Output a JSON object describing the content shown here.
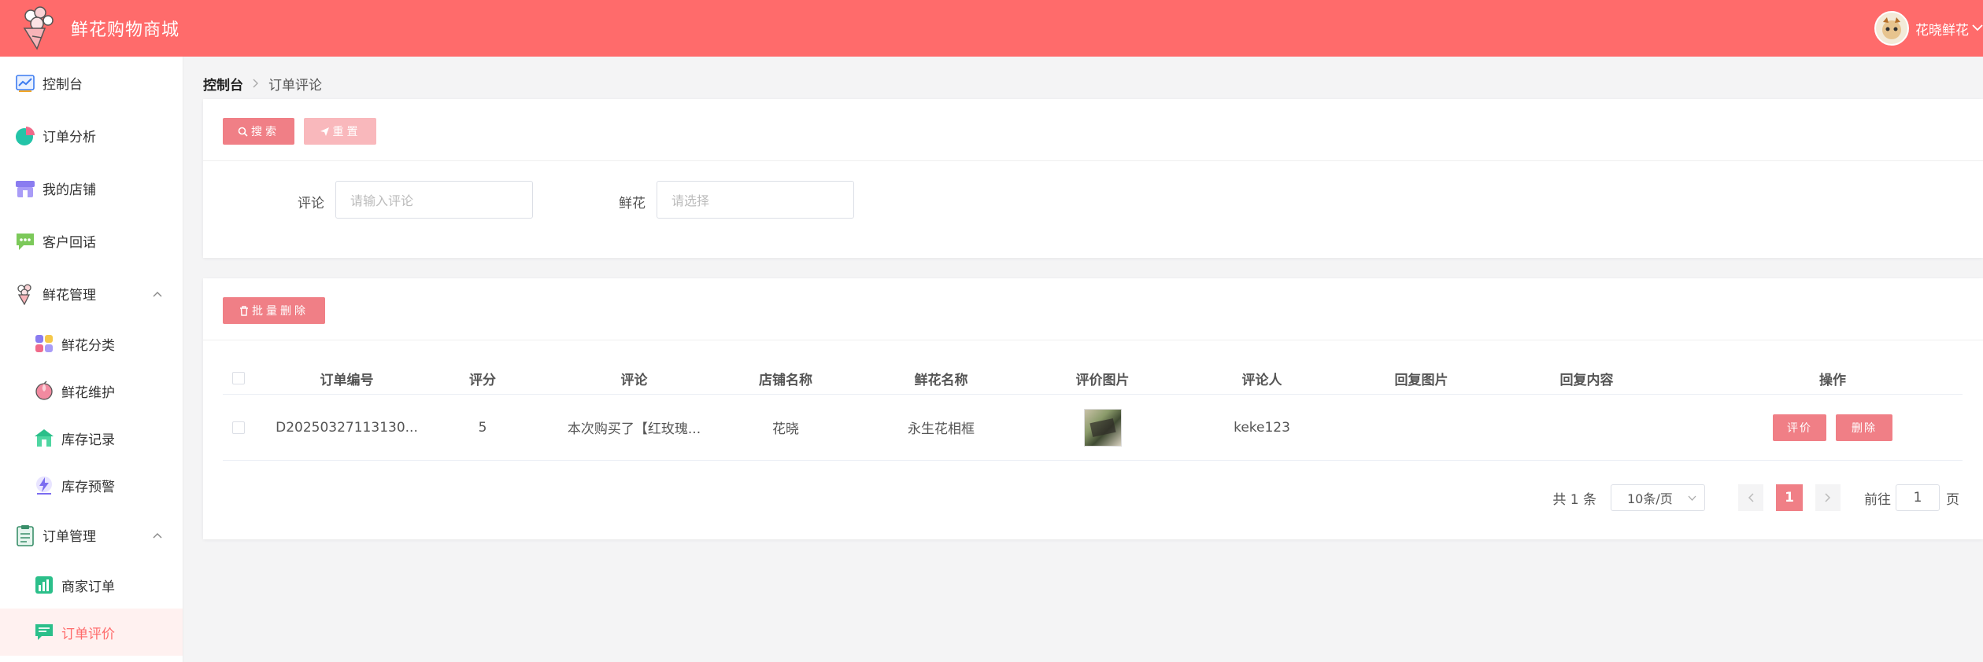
{
  "app": {
    "title": "鲜花购物商城"
  },
  "user": {
    "name": "花晓鲜花"
  },
  "sidebar": {
    "items": [
      {
        "label": "控制台",
        "icon": "chart-line-icon"
      },
      {
        "label": "订单分析",
        "icon": "pie-chart-icon"
      },
      {
        "label": "我的店铺",
        "icon": "store-icon"
      },
      {
        "label": "客户回话",
        "icon": "chat-bubble-icon"
      },
      {
        "label": "鲜花管理",
        "icon": "flower-icon",
        "expanded": true
      },
      {
        "label": "鲜花分类",
        "icon": "category-grid-icon"
      },
      {
        "label": "鲜花维护",
        "icon": "peach-icon"
      },
      {
        "label": "库存记录",
        "icon": "warehouse-icon"
      },
      {
        "label": "库存预警",
        "icon": "lightning-icon"
      },
      {
        "label": "订单管理",
        "icon": "clipboard-icon",
        "expanded": true
      },
      {
        "label": "商家订单",
        "icon": "bar-chart-icon"
      },
      {
        "label": "订单评价",
        "icon": "comment-icon",
        "active": true
      }
    ]
  },
  "breadcrumb": {
    "home": "控制台",
    "current": "订单评论"
  },
  "search": {
    "search_button": "搜索",
    "reset_button": "重置",
    "comment_label": "评论",
    "comment_placeholder": "请输入评论",
    "flower_label": "鲜花",
    "flower_placeholder": "请选择"
  },
  "table": {
    "batch_delete": "批量删除",
    "headers": [
      "订单编号",
      "评分",
      "评论",
      "店铺名称",
      "鲜花名称",
      "评价图片",
      "评论人",
      "回复图片",
      "回复内容",
      "操作"
    ],
    "rows": [
      {
        "order_no": "D20250327113130...",
        "score": "5",
        "comment": "本次购买了【红玫瑰...",
        "shop": "花晓",
        "flower": "永生花相框",
        "reviewer": "keke123",
        "reply_image": "",
        "reply_content": "",
        "action_review": "评价",
        "action_delete": "删除"
      }
    ]
  },
  "pagination": {
    "total": "共 1 条",
    "page_size": "10条/页",
    "current_page": "1",
    "goto_label": "前往",
    "goto_value": "1",
    "page_suffix": "页"
  },
  "colors": {
    "header": "#ff6b6b",
    "primary": "#f07f86",
    "active_bg": "#fff1f0"
  }
}
